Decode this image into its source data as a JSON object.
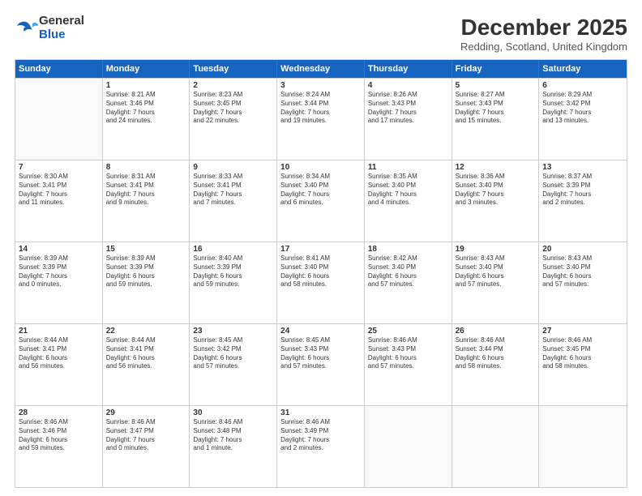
{
  "header": {
    "logo": {
      "general": "General",
      "blue": "Blue"
    },
    "title": "December 2025",
    "location": "Redding, Scotland, United Kingdom"
  },
  "calendar": {
    "days": [
      "Sunday",
      "Monday",
      "Tuesday",
      "Wednesday",
      "Thursday",
      "Friday",
      "Saturday"
    ],
    "rows": [
      [
        {
          "date": "",
          "info": ""
        },
        {
          "date": "1",
          "info": "Sunrise: 8:21 AM\nSunset: 3:46 PM\nDaylight: 7 hours\nand 24 minutes."
        },
        {
          "date": "2",
          "info": "Sunrise: 8:23 AM\nSunset: 3:45 PM\nDaylight: 7 hours\nand 22 minutes."
        },
        {
          "date": "3",
          "info": "Sunrise: 8:24 AM\nSunset: 3:44 PM\nDaylight: 7 hours\nand 19 minutes."
        },
        {
          "date": "4",
          "info": "Sunrise: 8:26 AM\nSunset: 3:43 PM\nDaylight: 7 hours\nand 17 minutes."
        },
        {
          "date": "5",
          "info": "Sunrise: 8:27 AM\nSunset: 3:43 PM\nDaylight: 7 hours\nand 15 minutes."
        },
        {
          "date": "6",
          "info": "Sunrise: 8:29 AM\nSunset: 3:42 PM\nDaylight: 7 hours\nand 13 minutes."
        }
      ],
      [
        {
          "date": "7",
          "info": "Sunrise: 8:30 AM\nSunset: 3:41 PM\nDaylight: 7 hours\nand 11 minutes."
        },
        {
          "date": "8",
          "info": "Sunrise: 8:31 AM\nSunset: 3:41 PM\nDaylight: 7 hours\nand 9 minutes."
        },
        {
          "date": "9",
          "info": "Sunrise: 8:33 AM\nSunset: 3:41 PM\nDaylight: 7 hours\nand 7 minutes."
        },
        {
          "date": "10",
          "info": "Sunrise: 8:34 AM\nSunset: 3:40 PM\nDaylight: 7 hours\nand 6 minutes."
        },
        {
          "date": "11",
          "info": "Sunrise: 8:35 AM\nSunset: 3:40 PM\nDaylight: 7 hours\nand 4 minutes."
        },
        {
          "date": "12",
          "info": "Sunrise: 8:36 AM\nSunset: 3:40 PM\nDaylight: 7 hours\nand 3 minutes."
        },
        {
          "date": "13",
          "info": "Sunrise: 8:37 AM\nSunset: 3:39 PM\nDaylight: 7 hours\nand 2 minutes."
        }
      ],
      [
        {
          "date": "14",
          "info": "Sunrise: 8:39 AM\nSunset: 3:39 PM\nDaylight: 7 hours\nand 0 minutes."
        },
        {
          "date": "15",
          "info": "Sunrise: 8:39 AM\nSunset: 3:39 PM\nDaylight: 6 hours\nand 59 minutes."
        },
        {
          "date": "16",
          "info": "Sunrise: 8:40 AM\nSunset: 3:39 PM\nDaylight: 6 hours\nand 59 minutes."
        },
        {
          "date": "17",
          "info": "Sunrise: 8:41 AM\nSunset: 3:40 PM\nDaylight: 6 hours\nand 58 minutes."
        },
        {
          "date": "18",
          "info": "Sunrise: 8:42 AM\nSunset: 3:40 PM\nDaylight: 6 hours\nand 57 minutes."
        },
        {
          "date": "19",
          "info": "Sunrise: 8:43 AM\nSunset: 3:40 PM\nDaylight: 6 hours\nand 57 minutes."
        },
        {
          "date": "20",
          "info": "Sunrise: 8:43 AM\nSunset: 3:40 PM\nDaylight: 6 hours\nand 57 minutes."
        }
      ],
      [
        {
          "date": "21",
          "info": "Sunrise: 8:44 AM\nSunset: 3:41 PM\nDaylight: 6 hours\nand 56 minutes."
        },
        {
          "date": "22",
          "info": "Sunrise: 8:44 AM\nSunset: 3:41 PM\nDaylight: 6 hours\nand 56 minutes."
        },
        {
          "date": "23",
          "info": "Sunrise: 8:45 AM\nSunset: 3:42 PM\nDaylight: 6 hours\nand 57 minutes."
        },
        {
          "date": "24",
          "info": "Sunrise: 8:45 AM\nSunset: 3:43 PM\nDaylight: 6 hours\nand 57 minutes."
        },
        {
          "date": "25",
          "info": "Sunrise: 8:46 AM\nSunset: 3:43 PM\nDaylight: 6 hours\nand 57 minutes."
        },
        {
          "date": "26",
          "info": "Sunrise: 8:46 AM\nSunset: 3:44 PM\nDaylight: 6 hours\nand 58 minutes."
        },
        {
          "date": "27",
          "info": "Sunrise: 8:46 AM\nSunset: 3:45 PM\nDaylight: 6 hours\nand 58 minutes."
        }
      ],
      [
        {
          "date": "28",
          "info": "Sunrise: 8:46 AM\nSunset: 3:46 PM\nDaylight: 6 hours\nand 59 minutes."
        },
        {
          "date": "29",
          "info": "Sunrise: 8:46 AM\nSunset: 3:47 PM\nDaylight: 7 hours\nand 0 minutes."
        },
        {
          "date": "30",
          "info": "Sunrise: 8:46 AM\nSunset: 3:48 PM\nDaylight: 7 hours\nand 1 minute."
        },
        {
          "date": "31",
          "info": "Sunrise: 8:46 AM\nSunset: 3:49 PM\nDaylight: 7 hours\nand 2 minutes."
        },
        {
          "date": "",
          "info": ""
        },
        {
          "date": "",
          "info": ""
        },
        {
          "date": "",
          "info": ""
        }
      ]
    ]
  }
}
